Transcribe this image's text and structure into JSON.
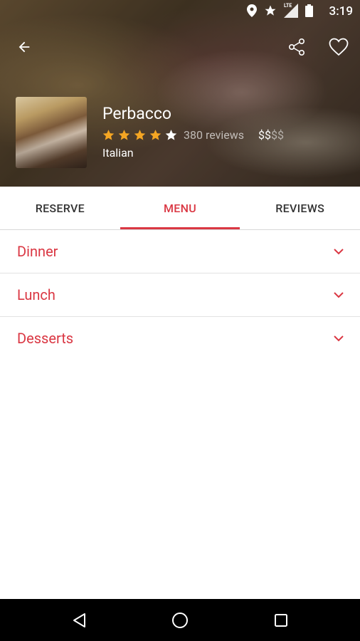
{
  "status_bar": {
    "time": "3:19",
    "network": "LTE"
  },
  "restaurant": {
    "name": "Perbacco",
    "rating": 4,
    "rating_max": 5,
    "reviews_label": "380 reviews",
    "price_on": "$$",
    "price_off": "$$",
    "cuisine": "Italian"
  },
  "tabs": [
    {
      "label": "RESERVE",
      "active": false
    },
    {
      "label": "MENU",
      "active": true
    },
    {
      "label": "REVIEWS",
      "active": false
    }
  ],
  "menu_sections": [
    {
      "label": "Dinner"
    },
    {
      "label": "Lunch"
    },
    {
      "label": "Desserts"
    }
  ],
  "colors": {
    "accent": "#da3743",
    "star": "#f5a623"
  }
}
